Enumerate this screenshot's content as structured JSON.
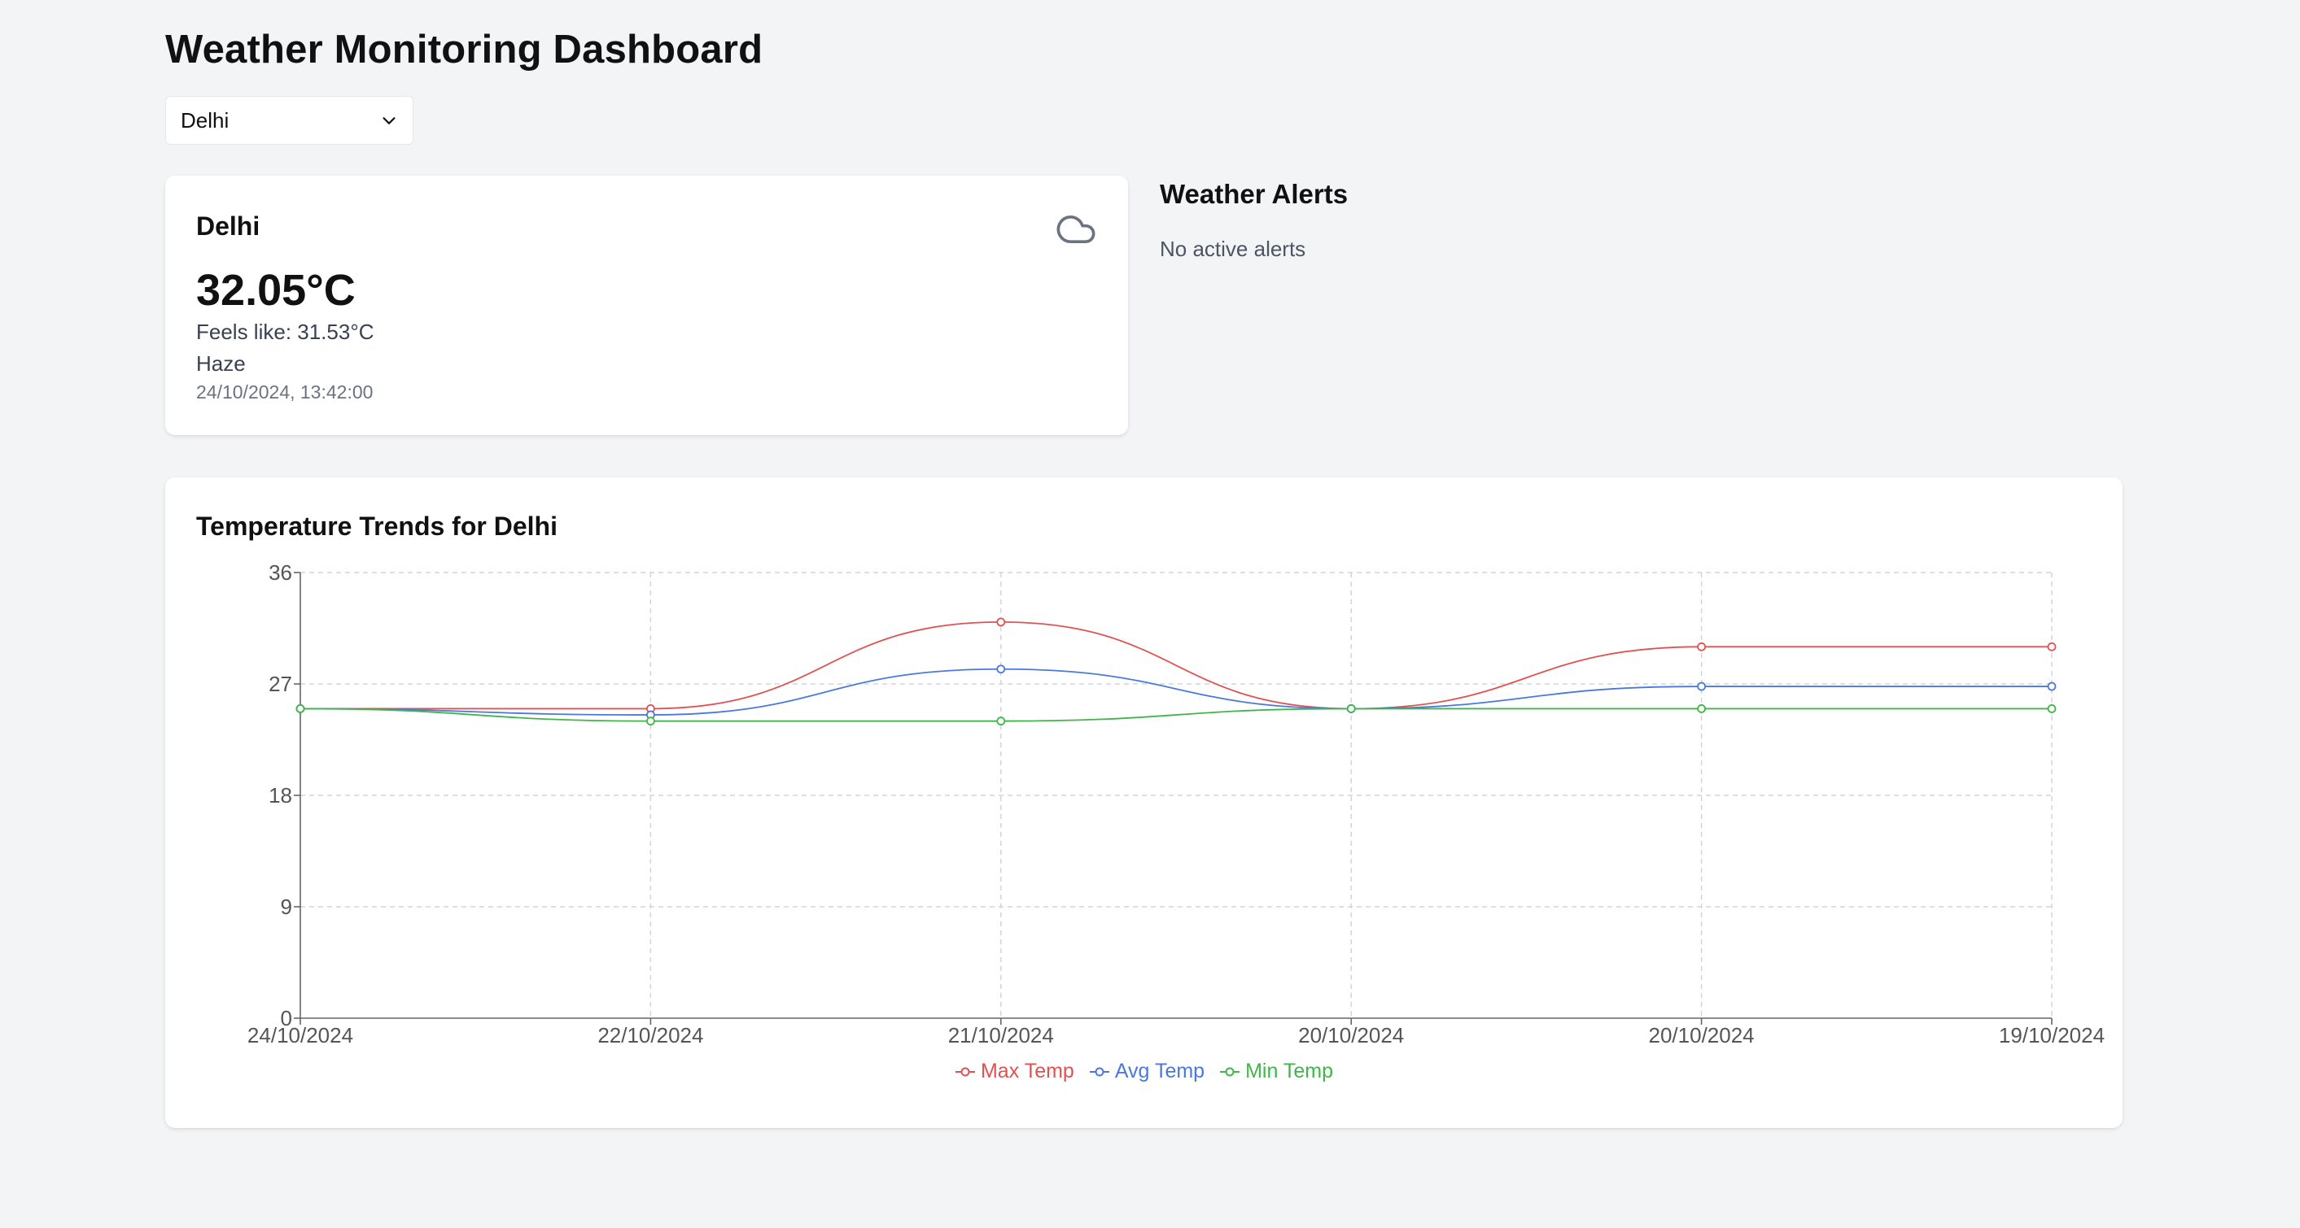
{
  "page_title": "Weather Monitoring Dashboard",
  "city_select": {
    "selected": "Delhi"
  },
  "weather_card": {
    "city": "Delhi",
    "icon": "cloud-icon",
    "temperature": "32.05°C",
    "feels_like": "Feels like: 31.53°C",
    "condition": "Haze",
    "timestamp": "24/10/2024, 13:42:00"
  },
  "alerts": {
    "title": "Weather Alerts",
    "empty_text": "No active alerts"
  },
  "chart_section": {
    "title": "Temperature Trends for Delhi"
  },
  "chart_data": {
    "type": "line",
    "title": "Temperature Trends for Delhi",
    "xlabel": "",
    "ylabel": "",
    "categories": [
      "24/10/2024",
      "22/10/2024",
      "21/10/2024",
      "20/10/2024",
      "20/10/2024",
      "19/10/2024"
    ],
    "ylim": [
      0,
      36
    ],
    "yticks": [
      0,
      9,
      18,
      27,
      36
    ],
    "grid": true,
    "legend_position": "bottom",
    "series": [
      {
        "name": "Max Temp",
        "color": "#e05252",
        "values": [
          25,
          25,
          32,
          25,
          30,
          30
        ]
      },
      {
        "name": "Avg Temp",
        "color": "#4a78e0",
        "values": [
          25,
          24.5,
          28.2,
          25,
          26.8,
          26.8
        ]
      },
      {
        "name": "Min Temp",
        "color": "#3fb54a",
        "values": [
          25,
          24,
          24,
          25,
          25,
          25
        ]
      }
    ]
  }
}
